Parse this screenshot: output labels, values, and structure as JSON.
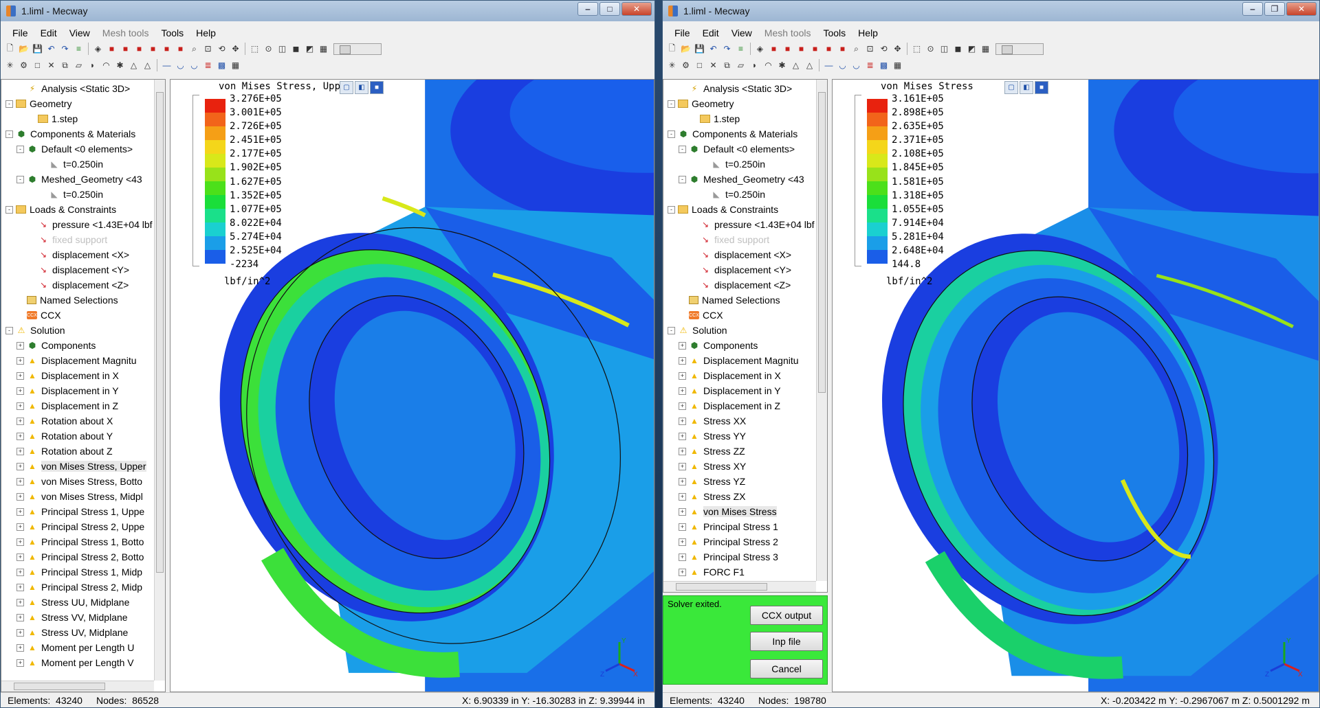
{
  "left": {
    "title": "1.liml - Mecway",
    "menu": [
      "File",
      "Edit",
      "View",
      "Mesh tools",
      "Tools",
      "Help"
    ],
    "tree": [
      {
        "label": "Analysis <Static 3D>",
        "icon": "analysis-icon",
        "level": 1,
        "exp": "none"
      },
      {
        "label": "Geometry",
        "icon": "folder-icon",
        "level": 0,
        "exp": "-"
      },
      {
        "label": "1.step",
        "icon": "folder-icon",
        "level": 2,
        "exp": "none"
      },
      {
        "label": "Components & Materials",
        "icon": "cube-icon",
        "level": 0,
        "exp": "-"
      },
      {
        "label": "Default <0 elements>",
        "icon": "cube-icon",
        "level": 1,
        "exp": "-"
      },
      {
        "label": "t=0.250in",
        "icon": "thickness-icon",
        "level": 3,
        "exp": "none"
      },
      {
        "label": "Meshed_Geometry <43",
        "icon": "cube-icon",
        "level": 1,
        "exp": "-"
      },
      {
        "label": "t=0.250in",
        "icon": "thickness-icon",
        "level": 3,
        "exp": "none"
      },
      {
        "label": "Loads & Constraints",
        "icon": "folder-icon",
        "level": 0,
        "exp": "-"
      },
      {
        "label": "pressure <1.43E+04 lbf",
        "icon": "arrow-icon",
        "level": 2,
        "exp": "none"
      },
      {
        "label": "fixed support",
        "icon": "arrow-icon",
        "level": 2,
        "exp": "none",
        "dim": true
      },
      {
        "label": "displacement <X>",
        "icon": "arrow-icon",
        "level": 2,
        "exp": "none"
      },
      {
        "label": "displacement <Y>",
        "icon": "arrow-icon",
        "level": 2,
        "exp": "none"
      },
      {
        "label": "displacement <Z>",
        "icon": "arrow-icon",
        "level": 2,
        "exp": "none"
      },
      {
        "label": "Named Selections",
        "icon": "named-icon",
        "level": 1,
        "exp": "none"
      },
      {
        "label": "CCX",
        "icon": "ccx-icon",
        "level": 1,
        "exp": "none"
      },
      {
        "label": "Solution",
        "icon": "solution-icon",
        "level": 0,
        "exp": "-"
      },
      {
        "label": "Components",
        "icon": "cube-icon",
        "level": 1,
        "exp": "+"
      },
      {
        "label": "Displacement Magnitu",
        "icon": "result-icon",
        "level": 1,
        "exp": "+"
      },
      {
        "label": "Displacement in X",
        "icon": "result-icon",
        "level": 1,
        "exp": "+"
      },
      {
        "label": "Displacement in Y",
        "icon": "result-icon",
        "level": 1,
        "exp": "+"
      },
      {
        "label": "Displacement in Z",
        "icon": "result-icon",
        "level": 1,
        "exp": "+"
      },
      {
        "label": "Rotation about X",
        "icon": "result-icon",
        "level": 1,
        "exp": "+"
      },
      {
        "label": "Rotation about Y",
        "icon": "result-icon",
        "level": 1,
        "exp": "+"
      },
      {
        "label": "Rotation about Z",
        "icon": "result-icon",
        "level": 1,
        "exp": "+"
      },
      {
        "label": "von Mises Stress, Upper",
        "icon": "result-icon",
        "level": 1,
        "exp": "+",
        "sel": true
      },
      {
        "label": "von Mises Stress, Botto",
        "icon": "result-icon",
        "level": 1,
        "exp": "+"
      },
      {
        "label": "von Mises Stress, Midpl",
        "icon": "result-icon",
        "level": 1,
        "exp": "+"
      },
      {
        "label": "Principal Stress 1, Uppe",
        "icon": "result-icon",
        "level": 1,
        "exp": "+"
      },
      {
        "label": "Principal Stress 2, Uppe",
        "icon": "result-icon",
        "level": 1,
        "exp": "+"
      },
      {
        "label": "Principal Stress 1, Botto",
        "icon": "result-icon",
        "level": 1,
        "exp": "+"
      },
      {
        "label": "Principal Stress 2, Botto",
        "icon": "result-icon",
        "level": 1,
        "exp": "+"
      },
      {
        "label": "Principal Stress 1, Midp",
        "icon": "result-icon",
        "level": 1,
        "exp": "+"
      },
      {
        "label": "Principal Stress 2, Midp",
        "icon": "result-icon",
        "level": 1,
        "exp": "+"
      },
      {
        "label": "Stress UU, Midplane",
        "icon": "result-icon",
        "level": 1,
        "exp": "+"
      },
      {
        "label": "Stress VV, Midplane",
        "icon": "result-icon",
        "level": 1,
        "exp": "+"
      },
      {
        "label": "Stress UV, Midplane",
        "icon": "result-icon",
        "level": 1,
        "exp": "+"
      },
      {
        "label": "Moment per Length U",
        "icon": "result-icon",
        "level": 1,
        "exp": "+"
      },
      {
        "label": "Moment per Length V",
        "icon": "result-icon",
        "level": 1,
        "exp": "+"
      }
    ],
    "legend": {
      "title": "von Mises Stress, Upper Surf",
      "values": [
        "3.276E+05",
        "3.001E+05",
        "2.726E+05",
        "2.451E+05",
        "2.177E+05",
        "1.902E+05",
        "1.627E+05",
        "1.352E+05",
        "1.077E+05",
        "8.022E+04",
        "5.274E+04",
        "2.525E+04",
        "-2234"
      ],
      "unit": "lbf/in^2"
    },
    "status": {
      "elements_label": "Elements:",
      "elements": "43240",
      "nodes_label": "Nodes:",
      "nodes": "86528",
      "coord": "X: 6.90339 in Y: -16.30283 in Z: 9.39944 in"
    }
  },
  "right": {
    "title": "1.liml - Mecway",
    "menu": [
      "File",
      "Edit",
      "View",
      "Mesh tools",
      "Tools",
      "Help"
    ],
    "tree": [
      {
        "label": "Analysis <Static 3D>",
        "icon": "analysis-icon",
        "level": 1,
        "exp": "none"
      },
      {
        "label": "Geometry",
        "icon": "folder-icon",
        "level": 0,
        "exp": "-"
      },
      {
        "label": "1.step",
        "icon": "folder-icon",
        "level": 2,
        "exp": "none"
      },
      {
        "label": "Components & Materials",
        "icon": "cube-icon",
        "level": 0,
        "exp": "-"
      },
      {
        "label": "Default <0 elements>",
        "icon": "cube-icon",
        "level": 1,
        "exp": "-"
      },
      {
        "label": "t=0.250in",
        "icon": "thickness-icon",
        "level": 3,
        "exp": "none"
      },
      {
        "label": "Meshed_Geometry <43",
        "icon": "cube-icon",
        "level": 1,
        "exp": "-"
      },
      {
        "label": "t=0.250in",
        "icon": "thickness-icon",
        "level": 3,
        "exp": "none"
      },
      {
        "label": "Loads & Constraints",
        "icon": "folder-icon",
        "level": 0,
        "exp": "-"
      },
      {
        "label": "pressure <1.43E+04 lbf",
        "icon": "arrow-icon",
        "level": 2,
        "exp": "none"
      },
      {
        "label": "fixed support",
        "icon": "arrow-icon",
        "level": 2,
        "exp": "none",
        "dim": true
      },
      {
        "label": "displacement <X>",
        "icon": "arrow-icon",
        "level": 2,
        "exp": "none"
      },
      {
        "label": "displacement <Y>",
        "icon": "arrow-icon",
        "level": 2,
        "exp": "none"
      },
      {
        "label": "displacement <Z>",
        "icon": "arrow-icon",
        "level": 2,
        "exp": "none"
      },
      {
        "label": "Named Selections",
        "icon": "named-icon",
        "level": 1,
        "exp": "none"
      },
      {
        "label": "CCX",
        "icon": "ccx-icon",
        "level": 1,
        "exp": "none"
      },
      {
        "label": "Solution",
        "icon": "solution-icon",
        "level": 0,
        "exp": "-"
      },
      {
        "label": "Components",
        "icon": "cube-icon",
        "level": 1,
        "exp": "+"
      },
      {
        "label": "Displacement Magnitu",
        "icon": "result-icon",
        "level": 1,
        "exp": "+"
      },
      {
        "label": "Displacement in X",
        "icon": "result-icon",
        "level": 1,
        "exp": "+"
      },
      {
        "label": "Displacement in Y",
        "icon": "result-icon",
        "level": 1,
        "exp": "+"
      },
      {
        "label": "Displacement in Z",
        "icon": "result-icon",
        "level": 1,
        "exp": "+"
      },
      {
        "label": "Stress XX",
        "icon": "result-icon",
        "level": 1,
        "exp": "+"
      },
      {
        "label": "Stress YY",
        "icon": "result-icon",
        "level": 1,
        "exp": "+"
      },
      {
        "label": "Stress ZZ",
        "icon": "result-icon",
        "level": 1,
        "exp": "+"
      },
      {
        "label": "Stress XY",
        "icon": "result-icon",
        "level": 1,
        "exp": "+"
      },
      {
        "label": "Stress YZ",
        "icon": "result-icon",
        "level": 1,
        "exp": "+"
      },
      {
        "label": "Stress ZX",
        "icon": "result-icon",
        "level": 1,
        "exp": "+"
      },
      {
        "label": "von Mises Stress",
        "icon": "result-icon",
        "level": 1,
        "exp": "+",
        "sel": true
      },
      {
        "label": "Principal Stress 1",
        "icon": "result-icon",
        "level": 1,
        "exp": "+"
      },
      {
        "label": "Principal Stress 2",
        "icon": "result-icon",
        "level": 1,
        "exp": "+"
      },
      {
        "label": "Principal Stress 3",
        "icon": "result-icon",
        "level": 1,
        "exp": "+"
      },
      {
        "label": "FORC F1",
        "icon": "result-icon",
        "level": 1,
        "exp": "+"
      }
    ],
    "legend": {
      "title": "von Mises Stress",
      "values": [
        "3.161E+05",
        "2.898E+05",
        "2.635E+05",
        "2.371E+05",
        "2.108E+05",
        "1.845E+05",
        "1.581E+05",
        "1.318E+05",
        "1.055E+05",
        "7.914E+04",
        "5.281E+04",
        "2.648E+04",
        "144.8"
      ],
      "unit": "lbf/in^2"
    },
    "solver": {
      "message": "Solver exited.",
      "ccx_output": "CCX output",
      "inp_file": "Inp file",
      "cancel": "Cancel",
      "color": "#3ae83a"
    },
    "status": {
      "elements_label": "Elements:",
      "elements": "43240",
      "nodes_label": "Nodes:",
      "nodes": "198780",
      "coord": "X: -0.203422 m Y: -0.2967067 m Z: 0.5001292 m"
    }
  },
  "legend_colors": [
    "#e8220e",
    "#f2641a",
    "#f59f16",
    "#f4d61a",
    "#d8e81a",
    "#98e21a",
    "#4ce01a",
    "#1ade3a",
    "#1ae08a",
    "#1ad0d0",
    "#1a9ee8",
    "#1a5ee8",
    "#1a20e0"
  ]
}
